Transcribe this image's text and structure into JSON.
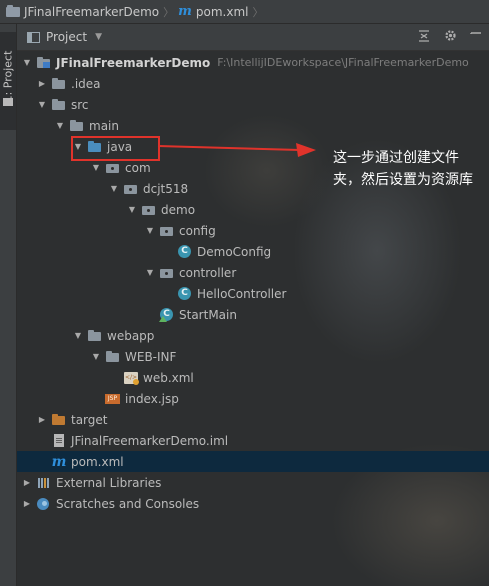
{
  "breadcrumb": {
    "project": "JFinalFreemarkerDemo",
    "file": "pom.xml",
    "separator": "〉"
  },
  "toolstrip": {
    "tab_label": "1: Project"
  },
  "project_panel": {
    "title": "Project",
    "caret": "▼",
    "header_icons": [
      "collapse-icon",
      "gear-icon",
      "hide-icon"
    ]
  },
  "tree": {
    "rows": [
      {
        "label": "JFinalFreemarkerDemo",
        "hint": "F:\\IntellijIDEworkspace\\JFinalFreemarkerDemo",
        "arrow": "▼",
        "icon": "project-folder-icon"
      },
      {
        "label": ".idea",
        "arrow": "▶",
        "icon": "folder-icon"
      },
      {
        "label": "src",
        "arrow": "▼",
        "icon": "folder-icon"
      },
      {
        "label": "main",
        "arrow": "▼",
        "icon": "folder-icon"
      },
      {
        "label": "java",
        "arrow": "▼",
        "icon": "source-root-icon"
      },
      {
        "label": "com",
        "arrow": "▼",
        "icon": "package-icon"
      },
      {
        "label": "dcjt518",
        "arrow": "▼",
        "icon": "package-icon"
      },
      {
        "label": "demo",
        "arrow": "▼",
        "icon": "package-icon"
      },
      {
        "label": "config",
        "arrow": "▼",
        "icon": "package-icon"
      },
      {
        "label": "DemoConfig",
        "icon": "class-icon"
      },
      {
        "label": "controller",
        "arrow": "▼",
        "icon": "package-icon"
      },
      {
        "label": "HelloController",
        "icon": "class-icon"
      },
      {
        "label": "StartMain",
        "icon": "main-class-icon"
      },
      {
        "label": "webapp",
        "arrow": "▼",
        "icon": "folder-icon"
      },
      {
        "label": "WEB-INF",
        "arrow": "▼",
        "icon": "folder-icon"
      },
      {
        "label": "web.xml",
        "icon": "xml-file-icon"
      },
      {
        "label": "index.jsp",
        "icon": "jsp-file-icon"
      },
      {
        "label": "target",
        "arrow": "▶",
        "icon": "excluded-folder-icon"
      },
      {
        "label": "JFinalFreemarkerDemo.iml",
        "icon": "iml-file-icon"
      },
      {
        "label": "pom.xml",
        "icon": "maven-file-icon"
      },
      {
        "label": "External Libraries",
        "arrow": "▶",
        "icon": "libraries-icon"
      },
      {
        "label": "Scratches and Consoles",
        "arrow": "▶",
        "icon": "scratches-icon"
      }
    ],
    "selected_index": 19
  },
  "annotation": {
    "text": "这一步通过创建文件夹，然后设置为资源库",
    "color": "#e0332b"
  },
  "colors": {
    "selection": "#0d293e",
    "excluded": "#d6894a",
    "source_root": "#4a8dbd"
  }
}
